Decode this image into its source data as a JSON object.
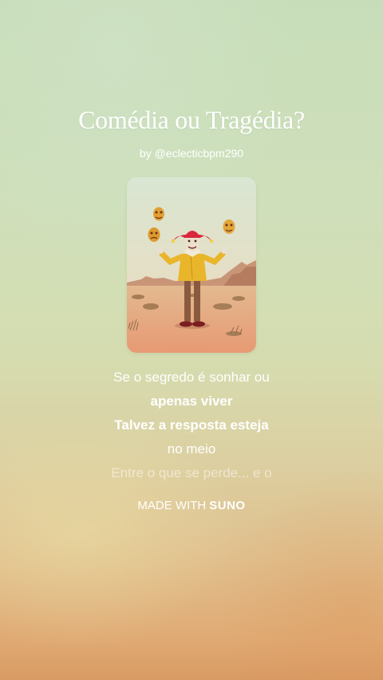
{
  "song": {
    "title": "Comédia ou Tragédia?",
    "byline": "by @eclecticbpm290"
  },
  "cover_art": {
    "icon": "jester-juggling-masks-illustration"
  },
  "lyrics": [
    {
      "text": "Se o segredo é sonhar ou",
      "style": "normal"
    },
    {
      "text": "apenas viver",
      "style": "bold"
    },
    {
      "text": "Talvez a resposta esteja",
      "style": "bold"
    },
    {
      "text": "no meio",
      "style": "normal"
    },
    {
      "text": "Entre o que se perde... e o",
      "style": "faded"
    }
  ],
  "watermark": {
    "prefix": "MADE WITH",
    "brand": "SUNO"
  },
  "colors": {
    "background_top": "#c7ddb9",
    "background_bottom": "#d99a63",
    "text": "#ffffff"
  }
}
